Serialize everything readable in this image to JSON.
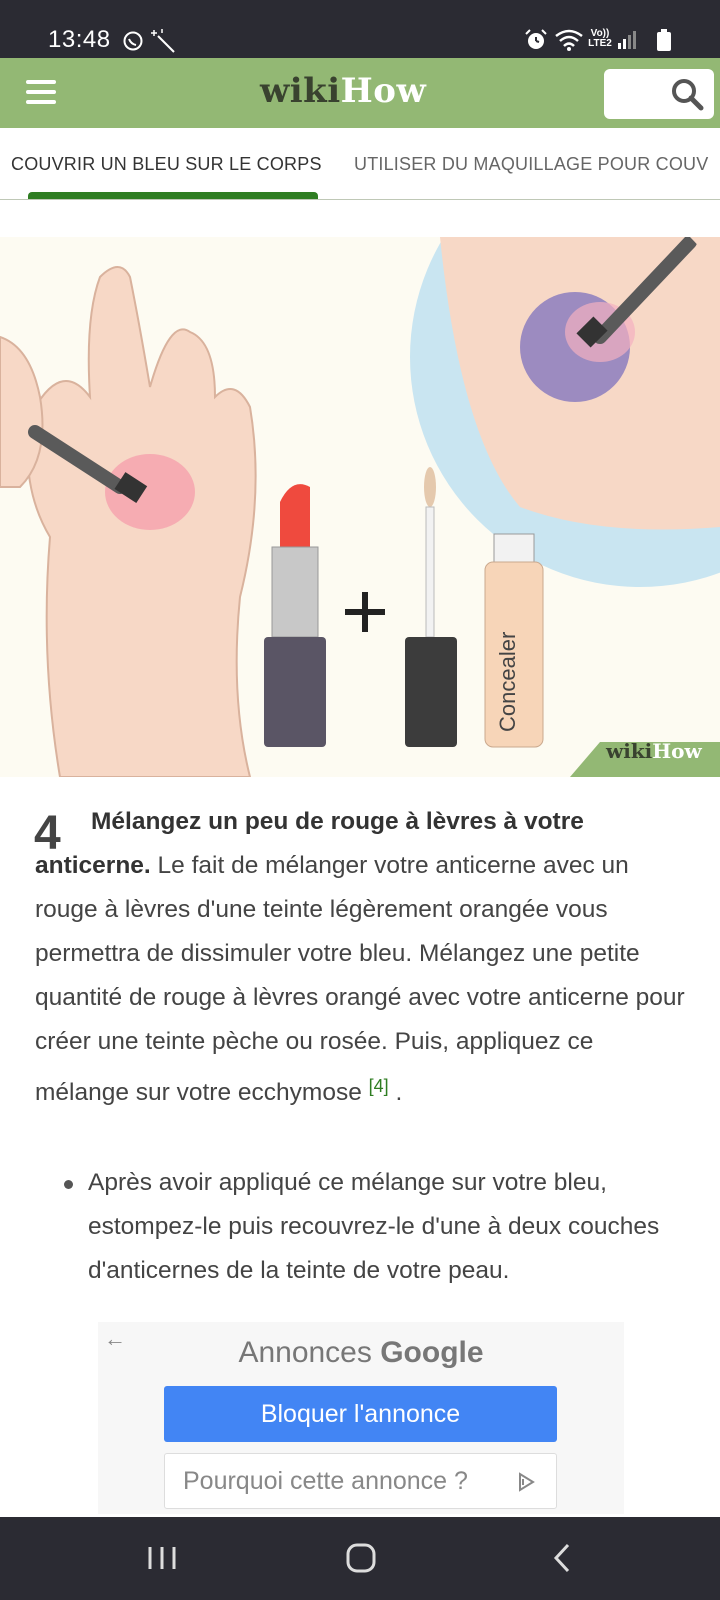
{
  "status_bar": {
    "time": "13:48",
    "network_label": "Vo)) LTE2",
    "icons": [
      "whatsapp-icon",
      "magic-wand-icon",
      "alarm-icon",
      "wifi-icon",
      "signal-icon",
      "battery-icon"
    ]
  },
  "header": {
    "logo_wiki": "wiki",
    "logo_how": "How",
    "menu_icon": "hamburger-icon",
    "search_icon": "search-icon"
  },
  "tabs": [
    {
      "label": "COUVRIR UN BLEU SUR LE CORPS",
      "active": true
    },
    {
      "label": "UTILISER DU MAQUILLAGE POUR COUV",
      "active": false
    }
  ],
  "illustration": {
    "concealer_label": "Concealer",
    "plus_sign": "+",
    "watermark_wiki": "wiki",
    "watermark_how": "How"
  },
  "step": {
    "number": "4",
    "title": "Mélangez un peu de rouge à lèvres à votre anticerne.",
    "body": " Le fait de mélanger votre anticerne avec un rouge à lèvres d'une teinte légèrement orangée vous permettra de dissimuler votre bleu. Mélangez une petite quantité de rouge à lèvres orangé avec votre anticerne pour créer une teinte pèche ou rosée. Puis, appliquez ce mélange sur votre ecchymose",
    "reference": "[4]",
    "end": " ."
  },
  "bullets": [
    "Après avoir appliqué ce mélange sur votre bleu, estompez-le puis recouvrez-le d'une à deux couches d'anticernes de la teinte de votre peau."
  ],
  "ad": {
    "back_arrow": "←",
    "title_prefix": "Annonces",
    "title_brand": "Google",
    "block_button": "Bloquer l'annonce",
    "why_button": "Pourquoi cette annonce ?"
  },
  "nav_bar": {
    "buttons": [
      "recent-apps",
      "home",
      "back"
    ]
  },
  "colors": {
    "header_green": "#93b874",
    "tab_indicator": "#2f7d22",
    "ad_blue": "#4285f4",
    "system_bar": "#2b2b33"
  }
}
